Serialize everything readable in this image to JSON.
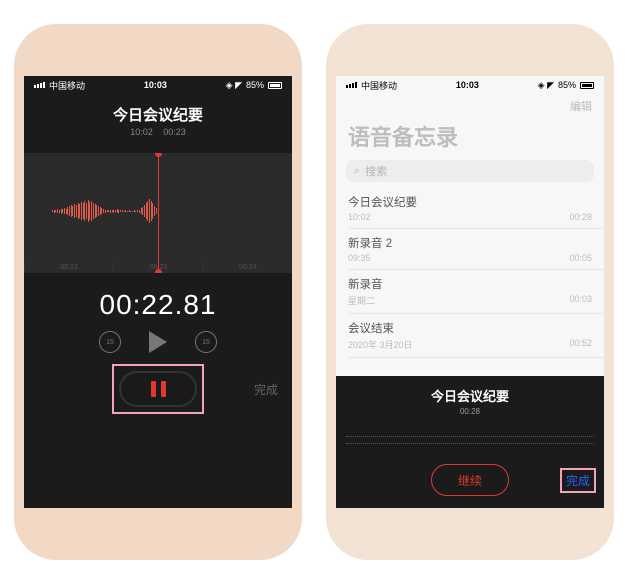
{
  "status": {
    "carrier": "中国移动",
    "time": "10:03",
    "battery": "85%"
  },
  "left": {
    "title": "今日会议纪要",
    "sub_time": "10:02",
    "sub_dur": "00:23",
    "ticks": [
      "00:22",
      "00:23",
      "00:24"
    ],
    "big_time": "00:22.81",
    "jump_back": "15",
    "jump_fwd": "15",
    "done": "完成"
  },
  "right": {
    "edit": "编辑",
    "heading": "语音备忘录",
    "search_placeholder": "搜索",
    "items": [
      {
        "title": "今日会议纪要",
        "meta": "10:02",
        "dur": "00:28"
      },
      {
        "title": "新录音 2",
        "meta": "09:35",
        "dur": "00:05"
      },
      {
        "title": "新录音",
        "meta": "星期二",
        "dur": "00:03"
      },
      {
        "title": "会议结束",
        "meta": "2020年 3月20日",
        "dur": "00:52"
      }
    ],
    "player_title": "今日会议纪要",
    "player_dur": "00:28",
    "continue": "继续",
    "done": "完成"
  }
}
